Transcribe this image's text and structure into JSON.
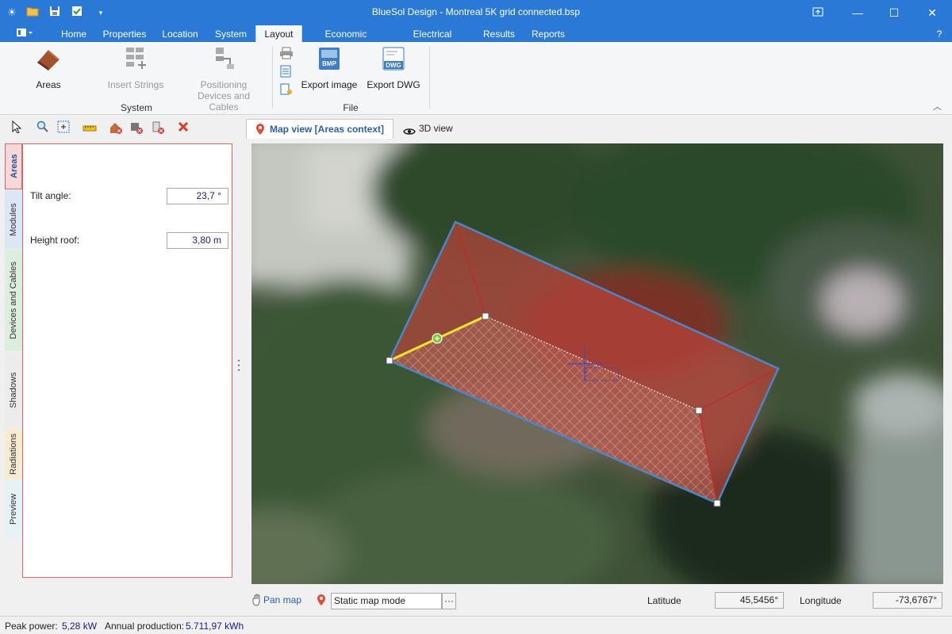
{
  "window": {
    "title": "BlueSol Design - Montreal 5K grid connected.bsp"
  },
  "quick_access": {
    "icons": [
      "app-sun-icon",
      "open-folder-icon",
      "save-icon",
      "checklist-icon",
      "dropdown-arrow-icon"
    ]
  },
  "tabs": [
    {
      "label": "Home"
    },
    {
      "label": "Properties"
    },
    {
      "label": "Location"
    },
    {
      "label": "System"
    },
    {
      "label": "Layout"
    },
    {
      "label": "Economic analysis"
    },
    {
      "label": "Electrical scheme"
    },
    {
      "label": "Results"
    },
    {
      "label": "Reports"
    }
  ],
  "active_tab": "Layout",
  "help_label": "?",
  "ribbon": {
    "areas_label": "Areas",
    "insert_strings_label": "Insert Strings",
    "positioning_line1": "Positioning",
    "positioning_line2": "Devices and Cables",
    "system_group": "System",
    "export_image_label": "Export image",
    "export_dwg_label": "Export DWG",
    "file_group": "File",
    "bmp_badge": "BMP",
    "dwg_badge": "DWG"
  },
  "side_tabs": [
    {
      "label": "Areas"
    },
    {
      "label": "Modules"
    },
    {
      "label": "Devices and Cables"
    },
    {
      "label": "Shadows"
    },
    {
      "label": "Radiations"
    },
    {
      "label": "Preview"
    }
  ],
  "panel": {
    "tilt_label": "Tilt angle:",
    "tilt_value": "23,7 °",
    "height_label": "Height roof:",
    "height_value": "3,80 m"
  },
  "map_tabs": {
    "map_view": "Map view [Areas context]",
    "view_3d": "3D view"
  },
  "map_footer": {
    "pan_map": "Pan map",
    "map_mode": "Static map mode",
    "more_button": "···",
    "latitude_label": "Latitude",
    "latitude_value": "45,5456°",
    "longitude_label": "Longitude",
    "longitude_value": "-73,6767°"
  },
  "status": {
    "peak_label": "Peak power:",
    "peak_value": "5,28 kW",
    "annual_label": "Annual production:",
    "annual_value": "5.711,97 kWh"
  },
  "colors": {
    "accent": "#2b79d6",
    "roof": "#b5443a",
    "outline": "#4a86c8",
    "ridge_selected": "#f2e52a"
  }
}
